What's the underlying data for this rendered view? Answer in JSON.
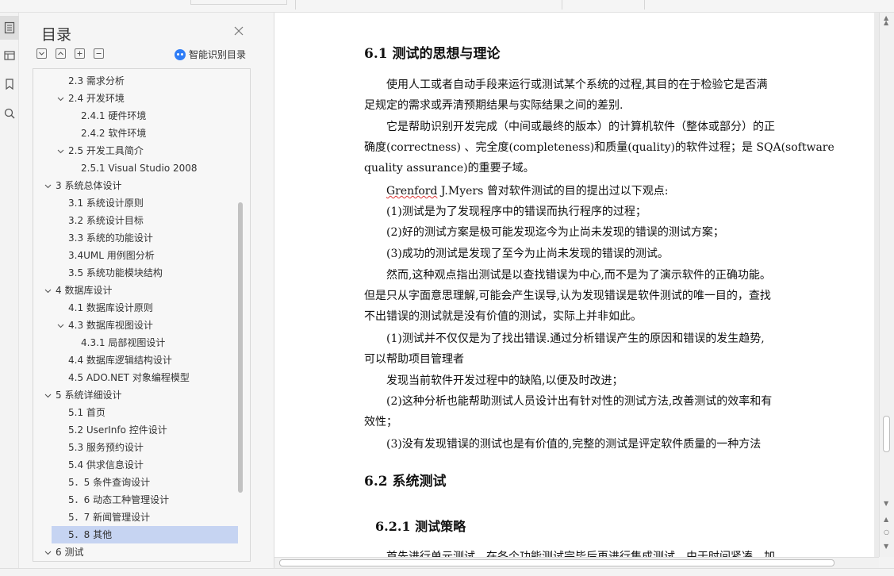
{
  "toc_panel": {
    "title": "目录",
    "smart_label": "智能识别目录",
    "items": [
      {
        "label": "2.3  需求分析",
        "level": 1,
        "caret": ""
      },
      {
        "label": "2.4  开发环境",
        "level": 1,
        "caret": "down"
      },
      {
        "label": "2.4.1 硬件环境",
        "level": 2,
        "caret": ""
      },
      {
        "label": "2.4.2 软件环境",
        "level": 2,
        "caret": ""
      },
      {
        "label": "2.5 开发工具简介",
        "level": 1,
        "caret": "down"
      },
      {
        "label": "2.5.1 Visual Studio 2008",
        "level": 2,
        "caret": ""
      },
      {
        "label": "3 系统总体设计",
        "level": 0,
        "caret": "down"
      },
      {
        "label": "3.1 系统设计原则",
        "level": 1,
        "caret": ""
      },
      {
        "label": "3.2 系统设计目标",
        "level": 1,
        "caret": ""
      },
      {
        "label": "3.3 系统的功能设计",
        "level": 1,
        "caret": ""
      },
      {
        "label": "3.4UML 用例图分析",
        "level": 1,
        "caret": ""
      },
      {
        "label": "3.5 系统功能模块结构",
        "level": 1,
        "caret": ""
      },
      {
        "label": "4 数据库设计",
        "level": 0,
        "caret": "down"
      },
      {
        "label": "4.1 数据库设计原则",
        "level": 1,
        "caret": ""
      },
      {
        "label": "4.3 数据库视图设计",
        "level": 1,
        "caret": "down"
      },
      {
        "label": "4.3.1 局部视图设计",
        "level": 2,
        "caret": ""
      },
      {
        "label": "4.4 数据库逻辑结构设计",
        "level": 1,
        "caret": ""
      },
      {
        "label": "4.5 ADO.NET  对象编程模型",
        "level": 1,
        "caret": ""
      },
      {
        "label": "5 系统详细设计",
        "level": 0,
        "caret": "down"
      },
      {
        "label": "5.1 首页",
        "level": 1,
        "caret": ""
      },
      {
        "label": "5.2 UserInfo 控件设计",
        "level": 1,
        "caret": ""
      },
      {
        "label": "5.3  服务预约设计",
        "level": 1,
        "caret": ""
      },
      {
        "label": "5.4 供求信息设计",
        "level": 1,
        "caret": ""
      },
      {
        "label": "5．5 条件查询设计",
        "level": 1,
        "caret": ""
      },
      {
        "label": "5．6 动态工种管理设计",
        "level": 1,
        "caret": ""
      },
      {
        "label": "5．7 新闻管理设计",
        "level": 1,
        "caret": ""
      },
      {
        "label": "5．8  其他",
        "level": 1,
        "caret": "",
        "selected": true
      },
      {
        "label": "6 测试",
        "level": 0,
        "caret": "down"
      }
    ]
  },
  "document": {
    "heading_6_1": "6.1 测试的思想与理论",
    "p1_l1": "使用人工或者自动手段来运行或测试某个系统的过程,其目的在于检验它是否满",
    "p1_l2": "足规定的需求或弄清预期结果与实际结果之间的差别.",
    "p2_l1": "它是帮助识别开发完成（中间或最终的版本）的计算机软件（整体或部分）的正",
    "p2_l2": "确度(correctness)  、完全度(completeness)和质量(quality)的软件过程；是 SQA(software",
    "p2_l3": "quality assurance)的重要子域。",
    "p3_a": "Grenford",
    "p3_b": " J.Myers 曾对软件测试的目的提出过以下观点:",
    "p4": "(1)测试是为了发现程序中的错误而执行程序的过程；",
    "p5": "(2)好的测试方案是极可能发现迄今为止尚未发现的错误的测试方案；",
    "p6": "(3)成功的测试是发现了至今为止尚未发现的错误的测试。",
    "p7_l1": "然而,这种观点指出测试是以查找错误为中心,而不是为了演示软件的正确功能。",
    "p7_l2": "但是只从字面意思理解,可能会产生误导,认为发现错误是软件测试的唯一目的，查找",
    "p7_l3": "不出错误的测试就是没有价值的测试，实际上并非如此。",
    "p8_l1": "(1)测试并不仅仅是为了找出错误.通过分析错误产生的原因和错误的发生趋势,",
    "p8_l2": "可以帮助项目管理者",
    "p9": "发现当前软件开发过程中的缺陷,以便及时改进；",
    "p10_l1": "(2)这种分析也能帮助测试人员设计出有针对性的测试方法,改善测试的效率和有",
    "p10_l2": "效性；",
    "p11": "(3)没有发现错误的测试也是有价值的,完整的测试是评定软件质量的一种方法",
    "heading_6_2": "6.2 系统测试",
    "heading_6_2_1": "6.2.1 测试策略",
    "p12_partial": "首先进行单元测试，在各个功能测试完毕后再进行集成测试，由于时间紧凑，加"
  }
}
